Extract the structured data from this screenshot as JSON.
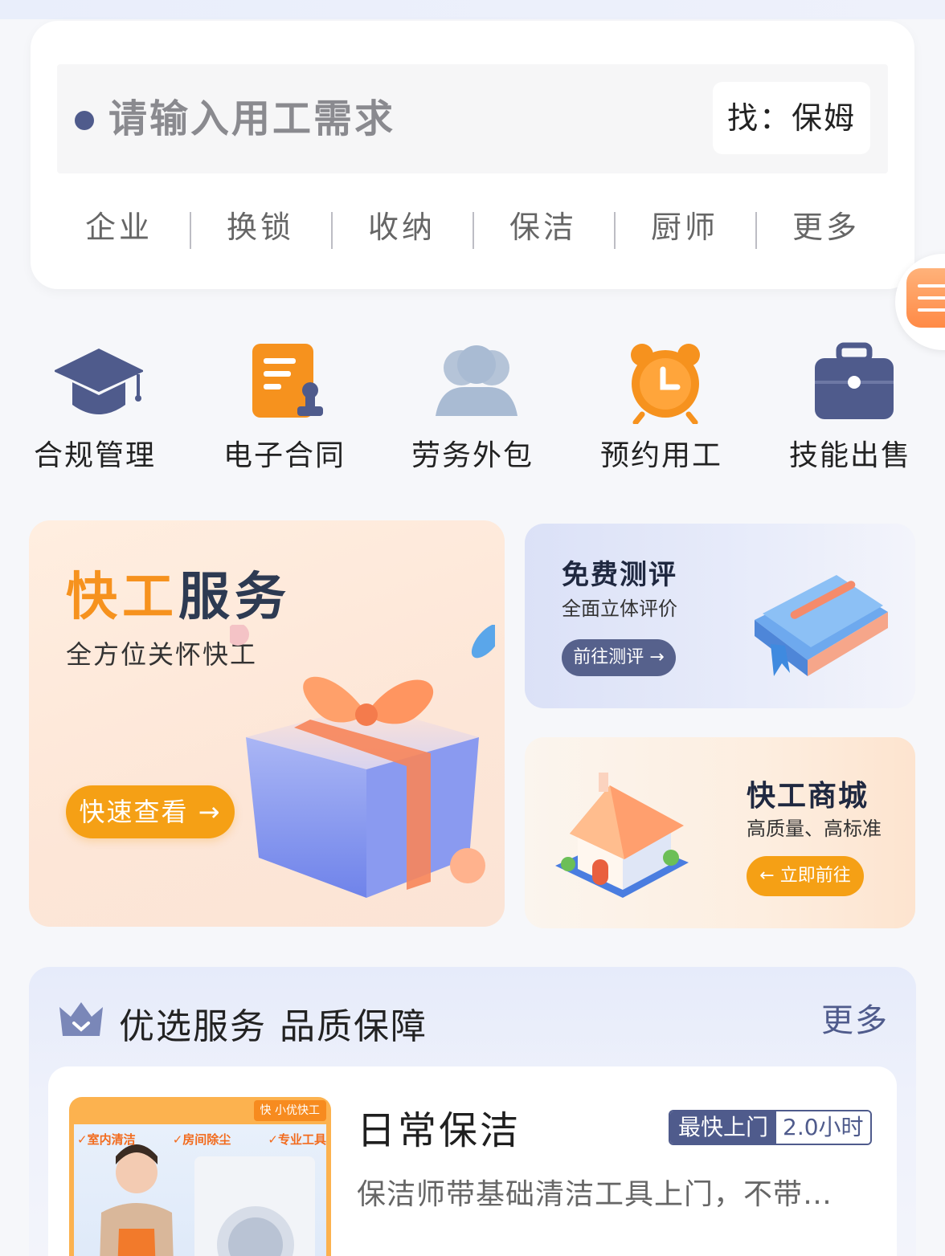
{
  "search": {
    "placeholder": "请输入用工需求",
    "find_label": "找：保姆",
    "tags": [
      "企业",
      "换锁",
      "收纳",
      "保洁",
      "厨师",
      "更多"
    ]
  },
  "services": [
    {
      "label": "合规管理",
      "icon": "graduation-cap-icon"
    },
    {
      "label": "电子合同",
      "icon": "contract-icon"
    },
    {
      "label": "劳务外包",
      "icon": "people-icon"
    },
    {
      "label": "预约用工",
      "icon": "alarm-clock-icon"
    },
    {
      "label": "技能出售",
      "icon": "briefcase-icon"
    }
  ],
  "banners": {
    "left": {
      "title_orange": "快工",
      "title_dark": "服务",
      "subtitle": "全方位关怀快工",
      "button": "快速查看 →"
    },
    "right_top": {
      "title": "免费测评",
      "subtitle": "全面立体评价",
      "button": "前往测评 →"
    },
    "right_bottom": {
      "title": "快工商城",
      "subtitle": "高质量、高标准",
      "button": "← 立即前往"
    }
  },
  "featured": {
    "title": "优选服务 品质保障",
    "more": "更多",
    "item": {
      "name": "日常保洁",
      "badge_label": "最快上门",
      "badge_value": "2.0小时",
      "description": "保洁师带基础清洁工具上门，不带…",
      "image_logo": "快 小优快工",
      "image_tags": [
        "✓室内清洁",
        "✓房间除尘",
        "✓专业工具"
      ]
    }
  },
  "colors": {
    "accent_orange": "#f5a015",
    "navy": "#4f5b8c",
    "background": "#f6f7fa"
  }
}
